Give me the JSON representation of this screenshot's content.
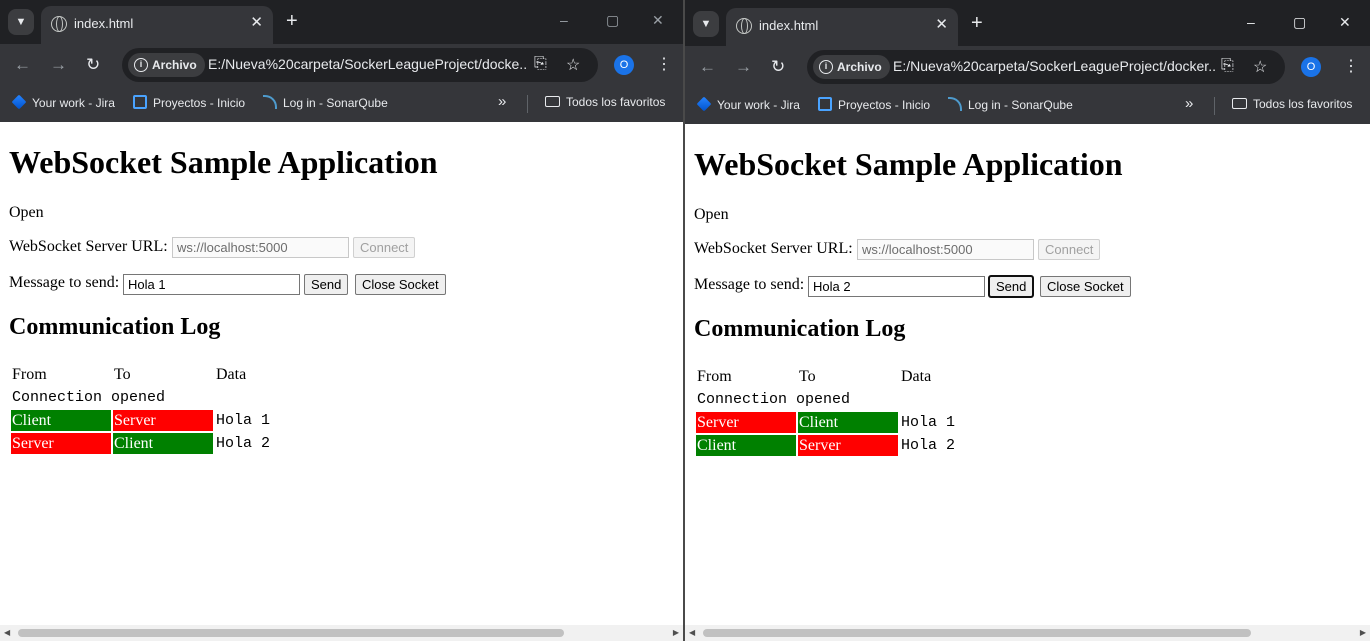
{
  "windows": [
    {
      "id": "left",
      "tab": {
        "title": "index.html",
        "close": "✕"
      },
      "controls": {
        "new_tab": "+",
        "minimize": "–",
        "maximize": "▢",
        "close": "✕"
      },
      "omnibox": {
        "chip": "Archivo",
        "url": "E:/Nueva%20carpeta/SockerLeagueProject/docke..."
      },
      "profile_initial": "O",
      "page": {
        "title": "WebSocket Sample Application",
        "status": "Open",
        "server_url_label": "WebSocket Server URL:",
        "server_url_value": "ws://localhost:5000",
        "connect_label": "Connect",
        "message_label": "Message to send:",
        "message_value": "Hola 1",
        "send_label": "Send",
        "close_socket_label": "Close Socket",
        "log_title": "Communication Log",
        "log_headers": [
          "From",
          "To",
          "Data"
        ],
        "log_connection": "Connection opened",
        "log_rows": [
          {
            "from": "Client",
            "to": "Server",
            "data": "Hola 1"
          },
          {
            "from": "Server",
            "to": "Client",
            "data": "Hola 2"
          }
        ]
      }
    },
    {
      "id": "right",
      "tab": {
        "title": "index.html",
        "close": "✕"
      },
      "controls": {
        "new_tab": "+",
        "minimize": "–",
        "maximize": "▢",
        "close": "✕"
      },
      "omnibox": {
        "chip": "Archivo",
        "url": "E:/Nueva%20carpeta/SockerLeagueProject/docker..."
      },
      "profile_initial": "O",
      "page": {
        "title": "WebSocket Sample Application",
        "status": "Open",
        "server_url_label": "WebSocket Server URL:",
        "server_url_value": "ws://localhost:5000",
        "connect_label": "Connect",
        "message_label": "Message to send:",
        "message_value": "Hola 2",
        "send_label": "Send",
        "close_socket_label": "Close Socket",
        "log_title": "Communication Log",
        "log_headers": [
          "From",
          "To",
          "Data"
        ],
        "log_connection": "Connection opened",
        "log_rows": [
          {
            "from": "Server",
            "to": "Client",
            "data": "Hola 1"
          },
          {
            "from": "Client",
            "to": "Server",
            "data": "Hola 2"
          }
        ]
      }
    }
  ],
  "bookmarks": {
    "items": [
      "Your work - Jira",
      "Proyectos - Inicio",
      "Log in - SonarQube"
    ],
    "more": "»",
    "all_favorites": "Todos los favoritos"
  },
  "colors": {
    "client": "#008000",
    "server": "#ff0000",
    "chrome_dark": "#202124",
    "toolbar": "#35363a"
  }
}
